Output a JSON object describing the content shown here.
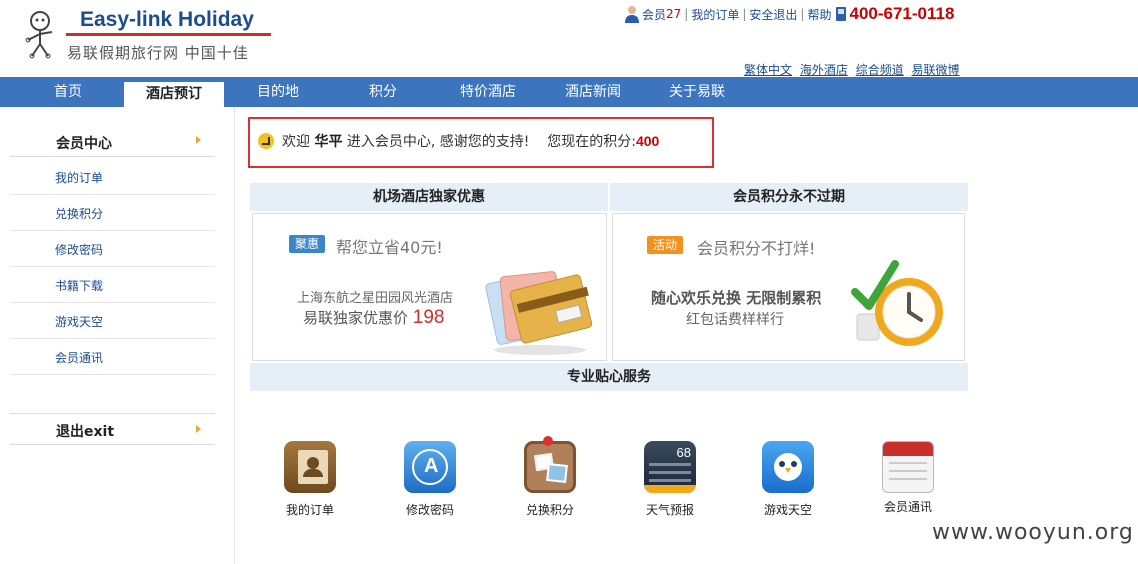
{
  "header": {
    "logo_title": "Easy-link Holiday",
    "logo_subtitle": "易联假期旅行网 中国十佳",
    "member_label": "会员",
    "member_count": "27",
    "my_orders": "我的订单",
    "logout": "安全退出",
    "help": "帮助",
    "hotline": "400-671-0118",
    "sub_links": [
      "繁体中文",
      "海外酒店",
      "综合频道",
      "易联微博"
    ]
  },
  "nav": {
    "items": [
      "首页",
      "酒店预订",
      "目的地",
      "积分",
      "特价酒店",
      "酒店新闻",
      "关于易联"
    ],
    "active": "酒店预订"
  },
  "sidebar": {
    "header": "会员中心",
    "items": [
      "我的订单",
      "兑换积分",
      "修改密码",
      "书籍下载",
      "游戏天空",
      "会员通讯"
    ],
    "exit": "退出exit"
  },
  "welcome": {
    "prefix": "欢迎",
    "name": "华平",
    "message": "进入会员中心, 感谢您的支持!",
    "points_label": "您现在的积分:",
    "points": "400"
  },
  "promo_left": {
    "heading": "机场酒店独家优惠",
    "badge": "聚惠",
    "title": "帮您立省40元!",
    "hotel": "上海东航之星田园风光酒店",
    "price_label": "易联独家优惠价",
    "price": "198"
  },
  "promo_right": {
    "heading": "会员积分永不过期",
    "badge": "活动",
    "title": "会员积分不打烊!",
    "line1": "随心欢乐兑换 无限制累积",
    "line2": "红包话费样样行"
  },
  "services": {
    "heading": "专业贴心服务",
    "items": [
      {
        "label": "我的订单",
        "icon": "contacts-book-icon"
      },
      {
        "label": "修改密码",
        "icon": "app-store-icon"
      },
      {
        "label": "兑换积分",
        "icon": "photo-board-icon"
      },
      {
        "label": "天气预报",
        "icon": "weather-icon"
      },
      {
        "label": "游戏天空",
        "icon": "bird-icon"
      },
      {
        "label": "会员通讯",
        "icon": "calendar-icon"
      }
    ],
    "weather_temp": "68"
  },
  "colors": {
    "nav_bg": "#3c74be",
    "hotline": "#cc0000",
    "highlight_border": "#d9322e",
    "section_bar": "#e6eef7",
    "badge_blue": "#3a86c8",
    "badge_orange": "#f0921e"
  },
  "watermark": "www.wooyun.org"
}
